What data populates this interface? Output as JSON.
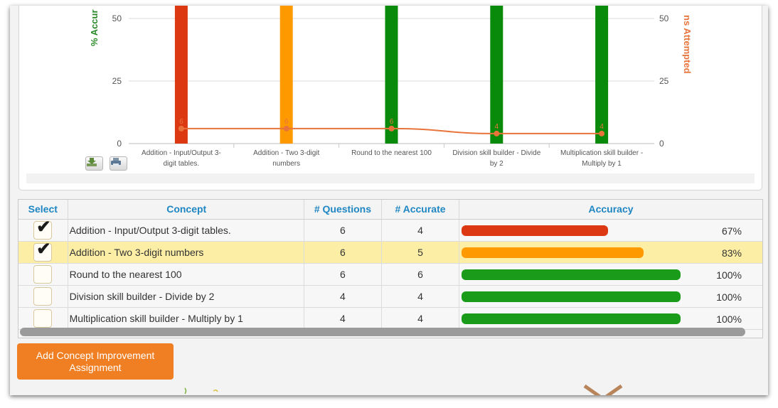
{
  "chart": {
    "left_axis_label": "% Accur",
    "right_axis_label": "ns Attempted",
    "left_ticks": [
      "50",
      "25",
      "0"
    ],
    "right_ticks": [
      "50",
      "25",
      "0"
    ],
    "download_icon": "download-icon",
    "print_icon": "print-icon"
  },
  "chart_data": {
    "type": "bar",
    "categories": [
      [
        "Addition - Input/Output 3-",
        "digit tables."
      ],
      [
        "Addition - Two 3-digit",
        "numbers"
      ],
      [
        "Round to the nearest 100"
      ],
      [
        "Division skill builder - Divide",
        "by 2"
      ],
      [
        "Multiplication skill builder -",
        "Multiply by 1"
      ]
    ],
    "series": [
      {
        "values": [
          67,
          83,
          100,
          100,
          100
        ],
        "colors": [
          "#dc3912",
          "#ff9900",
          "#0a8a0a",
          "#0a8a0a",
          "#0a8a0a"
        ]
      },
      {
        "type": "line",
        "values": [
          6,
          6,
          6,
          4,
          4
        ],
        "labels": [
          "6",
          "6",
          "6",
          "4",
          "4"
        ],
        "color": "#e8743b"
      }
    ],
    "ylim": [
      0,
      55
    ],
    "y_right_lim": [
      0,
      55
    ],
    "grid": true
  },
  "table": {
    "headers": [
      "Select",
      "Concept",
      "# Questions",
      "# Accurate",
      "Accuracy"
    ],
    "rows": [
      {
        "checked": true,
        "concept": "Addition - Input/Output 3-digit tables.",
        "questions": "6",
        "accurate": "4",
        "accuracy": 67,
        "accuracy_label": "67%",
        "bar_color": "#dc3912",
        "highlight": false
      },
      {
        "checked": true,
        "concept": "Addition - Two 3-digit numbers",
        "questions": "6",
        "accurate": "5",
        "accuracy": 83,
        "accuracy_label": "83%",
        "bar_color": "#ff9900",
        "highlight": true
      },
      {
        "checked": false,
        "concept": "Round to the nearest 100",
        "questions": "6",
        "accurate": "6",
        "accuracy": 100,
        "accuracy_label": "100%",
        "bar_color": "#1a9c1a",
        "highlight": false
      },
      {
        "checked": false,
        "concept": "Division skill builder - Divide by 2",
        "questions": "4",
        "accurate": "4",
        "accuracy": 100,
        "accuracy_label": "100%",
        "bar_color": "#1a9c1a",
        "highlight": false
      },
      {
        "checked": false,
        "concept": "Multiplication skill builder - Multiply by 1",
        "questions": "4",
        "accurate": "4",
        "accuracy": 100,
        "accuracy_label": "100%",
        "bar_color": "#1a9c1a",
        "highlight": false
      }
    ]
  },
  "actions": {
    "add_assignment_label": "Add Concept Improvement Assignment"
  }
}
